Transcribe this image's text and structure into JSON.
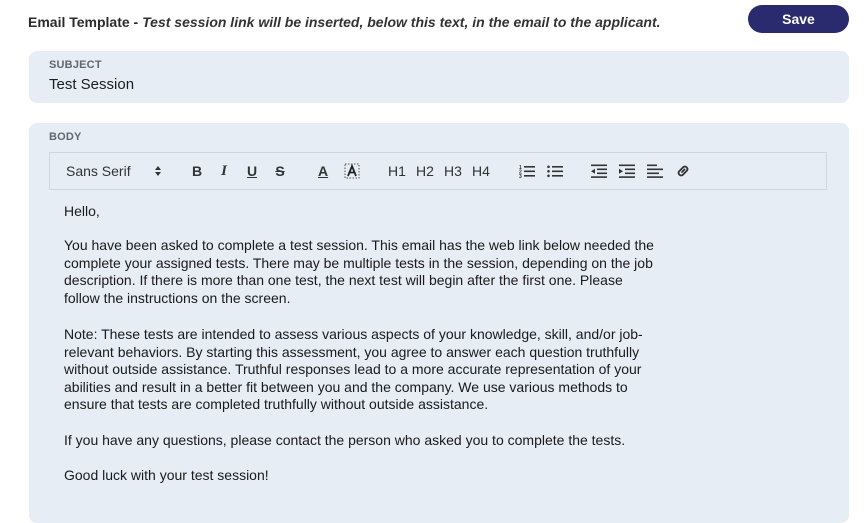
{
  "header": {
    "title": "Email Template",
    "separator": " - ",
    "note": "Test session link will be inserted, below this text, in the email to the applicant.",
    "save_label": "Save"
  },
  "subject": {
    "label": "SUBJECT",
    "value": "Test Session"
  },
  "body": {
    "label": "BODY",
    "toolbar": {
      "font": "Sans Serif",
      "bold": "B",
      "italic": "I",
      "underline": "U",
      "strike": "S",
      "font_color": "A",
      "h1": "H1",
      "h2": "H2",
      "h3": "H3",
      "h4": "H4",
      "icons": [
        "ordered-list-icon",
        "bullet-list-icon",
        "outdent-icon",
        "indent-icon",
        "align-icon",
        "link-icon"
      ]
    },
    "paragraphs": [
      "Hello,",
      "You have been asked to complete a test session. This email has the web link below needed the complete your assigned tests. There may be multiple tests in the session, depending on the job description. If there is more than one test, the next test will begin after the first one. Please follow the instructions on the screen.",
      "Note: These tests are intended to assess various aspects of your knowledge, skill, and/or job-relevant behaviors. By starting this assessment, you agree to answer each question truthfully without outside assistance. Truthful responses lead to a more accurate representation of your abilities and result in a better fit between you and the company. We use various methods to ensure that tests are completed truthfully without outside assistance.",
      "If you have any questions, please contact the person who asked you to complete the tests.",
      "Good luck with your test session!"
    ]
  },
  "colors": {
    "accent": "#2a2a6e",
    "card_bg": "#e6edf4"
  }
}
